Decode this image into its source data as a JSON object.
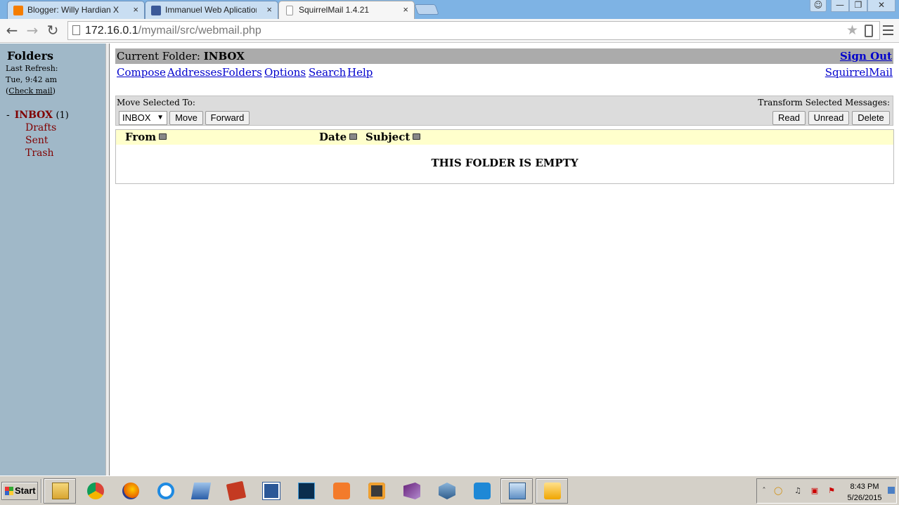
{
  "browser": {
    "tabs": [
      {
        "title": "Blogger: Willy Hardian XI TI",
        "favicon": "blogger-icon",
        "color": "#f57d00",
        "active": false
      },
      {
        "title": "Immanuel Web Aplication XI",
        "favicon": "facebook-icon",
        "color": "#3b5998",
        "active": false
      },
      {
        "title": "SquirrelMail 1.4.21",
        "favicon": "page-icon",
        "color": "#ffffff",
        "active": true
      }
    ],
    "close_glyph": "×",
    "url_host": "172.16.0.1",
    "url_path": "/mymail/src/webmail.php"
  },
  "sidebar": {
    "title": "Folders",
    "last_refresh_label": "Last Refresh:",
    "last_refresh_time": "Tue, 9:42 am",
    "check_mail_open": "(",
    "check_mail_label": "Check mail",
    "check_mail_close": ")",
    "folders": [
      {
        "dash": "-",
        "name": "INBOX",
        "count": "(1)"
      },
      {
        "name": "Drafts"
      },
      {
        "name": "Sent"
      },
      {
        "name": "Trash"
      }
    ]
  },
  "header": {
    "current_folder_label": "Current Folder:",
    "current_folder": "INBOX",
    "sign_out": "Sign Out",
    "brand_link": "SquirrelMail",
    "nav": [
      "Compose",
      "Addresses",
      "Folders",
      "Options",
      "Search",
      "Help"
    ]
  },
  "actions": {
    "move_label": "Move Selected To:",
    "move_target": "INBOX",
    "move_button": "Move",
    "forward_button": "Forward",
    "transform_label": "Transform Selected Messages:",
    "read_button": "Read",
    "unread_button": "Unread",
    "delete_button": "Delete"
  },
  "message_list": {
    "columns": [
      "From",
      "Date",
      "Subject"
    ],
    "empty_text": "THIS FOLDER IS EMPTY"
  },
  "taskbar": {
    "start_label": "Start",
    "apps": [
      "file-manager-icon",
      "chrome-icon",
      "firefox-icon",
      "internet-explorer-icon",
      "network-icon",
      "book-icon",
      "word-icon",
      "photoshop-icon",
      "xampp-icon",
      "sublime-icon",
      "visual-studio-icon",
      "virtualbox-icon",
      "wps-icon",
      "control-panel-icon",
      "outlook-icon"
    ],
    "clock_time": "8:43 PM",
    "clock_date": "5/26/2015"
  }
}
